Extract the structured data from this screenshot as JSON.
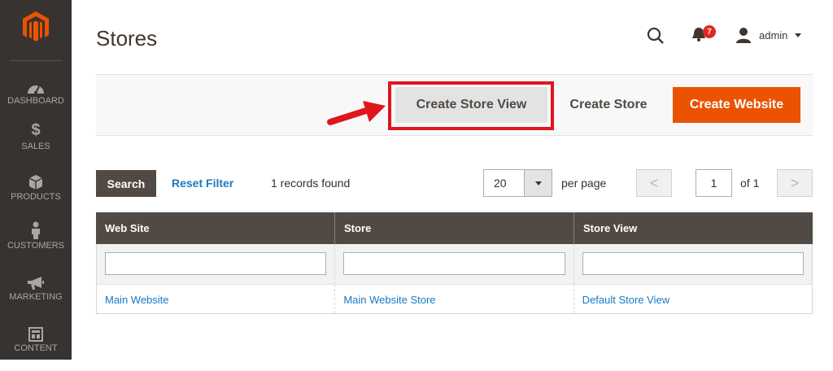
{
  "sidebar": {
    "logo_icon": "magento-logo-icon",
    "items": [
      {
        "label": "DASHBOARD",
        "icon": "speedometer-icon"
      },
      {
        "label": "SALES",
        "icon": "dollar-icon"
      },
      {
        "label": "PRODUCTS",
        "icon": "cube-icon"
      },
      {
        "label": "CUSTOMERS",
        "icon": "person-icon"
      },
      {
        "label": "MARKETING",
        "icon": "megaphone-icon"
      },
      {
        "label": "CONTENT",
        "icon": "layout-icon"
      }
    ]
  },
  "header": {
    "title": "Stores",
    "notification_count": "7",
    "user_name": "admin"
  },
  "actions": {
    "create_store_view": "Create Store View",
    "create_store": "Create Store",
    "create_website": "Create Website"
  },
  "toolbar": {
    "search_label": "Search",
    "reset_filter": "Reset Filter",
    "records_found": "1 records found",
    "per_page_value": "20",
    "per_page_label": "per page",
    "prev": "<",
    "page_number": "1",
    "page_of": "of 1",
    "next": ">"
  },
  "grid": {
    "columns": [
      "Web Site",
      "Store",
      "Store View"
    ],
    "rows": [
      [
        "Main Website",
        "Main Website Store",
        "Default Store View"
      ]
    ]
  },
  "colors": {
    "sidebar_bg": "#373330",
    "accent": "#eb5202",
    "highlight": "#e0151e",
    "link": "#1979c3",
    "grid_header": "#514943"
  }
}
